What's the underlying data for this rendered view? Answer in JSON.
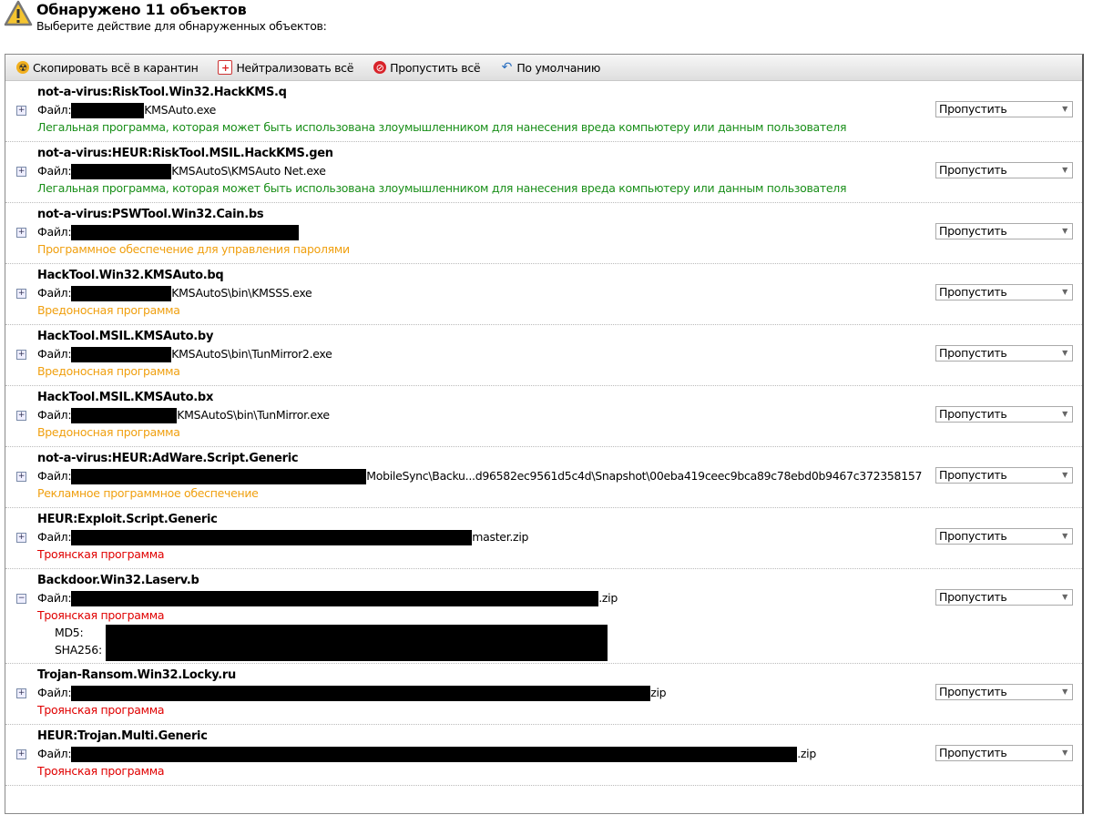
{
  "header": {
    "title": "Обнаружено 11 объектов",
    "subtitle": "Выберите действие для обнаруженных объектов:",
    "icon": "warning-icon"
  },
  "toolbar": {
    "quarantine_all": "Скопировать всё в карантин",
    "neutralize_all": "Нейтрализовать всё",
    "skip_all": "Пропустить всё",
    "default": "По умолчанию"
  },
  "file_label": "Файл:",
  "hash_labels": {
    "md5": "MD5:",
    "sha256": "SHA256:"
  },
  "colors": {
    "legal": "#1a8f1a",
    "warning": "#f0a010",
    "trojan": "#e00000"
  },
  "items": [
    {
      "name": "not-a-virus:RiskTool.Win32.HackKMS.q",
      "file": "KMSAuto.exe",
      "desc": "Легальная программа, которая может быть использована злоумышленником для нанесения вреда компьютеру или данным пользователя",
      "level": "green",
      "action": "Пропустить"
    },
    {
      "name": "not-a-virus:HEUR:RiskTool.MSIL.HackKMS.gen",
      "file": "KMSAutoS\\KMSAuto Net.exe",
      "desc": "Легальная программа, которая может быть использована злоумышленником для нанесения вреда компьютеру или данным пользователя",
      "level": "green",
      "action": "Пропустить"
    },
    {
      "name": "not-a-virus:PSWTool.Win32.Cain.bs",
      "file": "",
      "desc": "Программное обеспечение для управления паролями",
      "level": "orange",
      "action": "Пропустить"
    },
    {
      "name": "HackTool.Win32.KMSAuto.bq",
      "file": "KMSAutoS\\bin\\KMSSS.exe",
      "desc": "Вредоносная программа",
      "level": "orange",
      "action": "Пропустить"
    },
    {
      "name": "HackTool.MSIL.KMSAuto.by",
      "file": "KMSAutoS\\bin\\TunMirror2.exe",
      "desc": "Вредоносная программа",
      "level": "orange",
      "action": "Пропустить"
    },
    {
      "name": "HackTool.MSIL.KMSAuto.bx",
      "file": "KMSAutoS\\bin\\TunMirror.exe",
      "desc": "Вредоносная программа",
      "level": "orange",
      "action": "Пропустить"
    },
    {
      "name": "not-a-virus:HEUR:AdWare.Script.Generic",
      "file": "MobileSync\\Backu...d96582ec9561d5c4d\\Snapshot\\00eba419ceec9bca89c78ebd0b9467c372358157",
      "desc": "Рекламное программное обеспечение",
      "level": "orange",
      "action": "Пропустить"
    },
    {
      "name": "HEUR:Exploit.Script.Generic",
      "file": "master.zip",
      "desc": "Троянская программа",
      "level": "redt",
      "action": "Пропустить"
    },
    {
      "name": "Backdoor.Win32.Laserv.b",
      "file": ".zip",
      "desc": "Троянская программа",
      "level": "redt",
      "action": "Пропустить",
      "expanded": true
    },
    {
      "name": "Trojan-Ransom.Win32.Locky.ru",
      "file": "zip",
      "desc": "Троянская программа",
      "level": "redt",
      "action": "Пропустить"
    },
    {
      "name": "HEUR:Trojan.Multi.Generic",
      "file": ".zip",
      "desc": "Троянская программа",
      "level": "redt",
      "action": "Пропустить"
    }
  ]
}
